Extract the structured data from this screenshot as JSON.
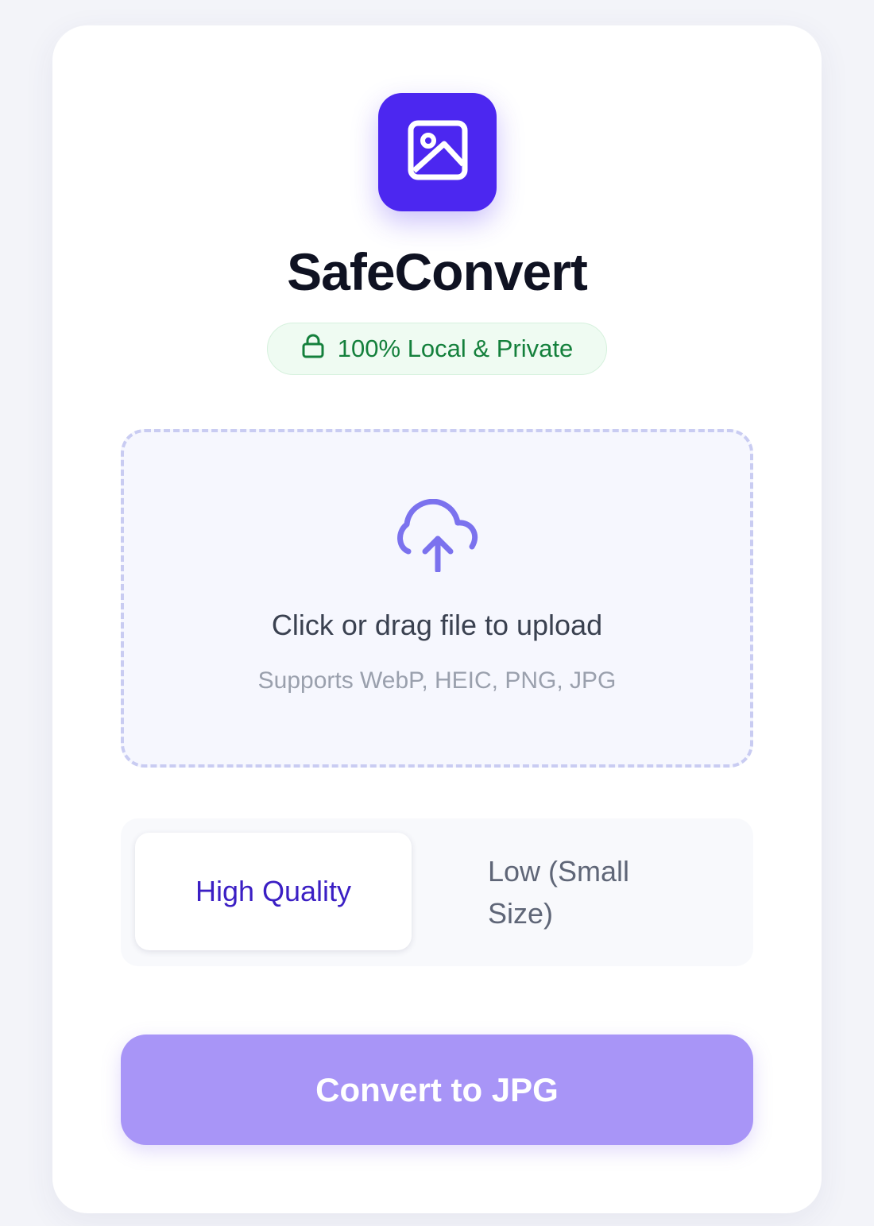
{
  "app": {
    "name": "SafeConvert",
    "badge_label": "100% Local & Private"
  },
  "upload": {
    "title": "Click or drag file to upload",
    "subtitle": "Supports WebP, HEIC, PNG, JPG"
  },
  "quality": {
    "options": [
      {
        "label": "High Quality",
        "selected": true
      },
      {
        "label": "Low (Small Size)",
        "selected": false
      }
    ]
  },
  "action": {
    "convert_label": "Convert to JPG"
  },
  "icons": {
    "logo": "image-icon",
    "badge": "lock-icon",
    "upload": "cloud-upload-icon"
  },
  "colors": {
    "accent": "#4c27f0",
    "button": "#a895f7",
    "badge_text": "#14803c",
    "upload_icon": "#7b72ee"
  }
}
